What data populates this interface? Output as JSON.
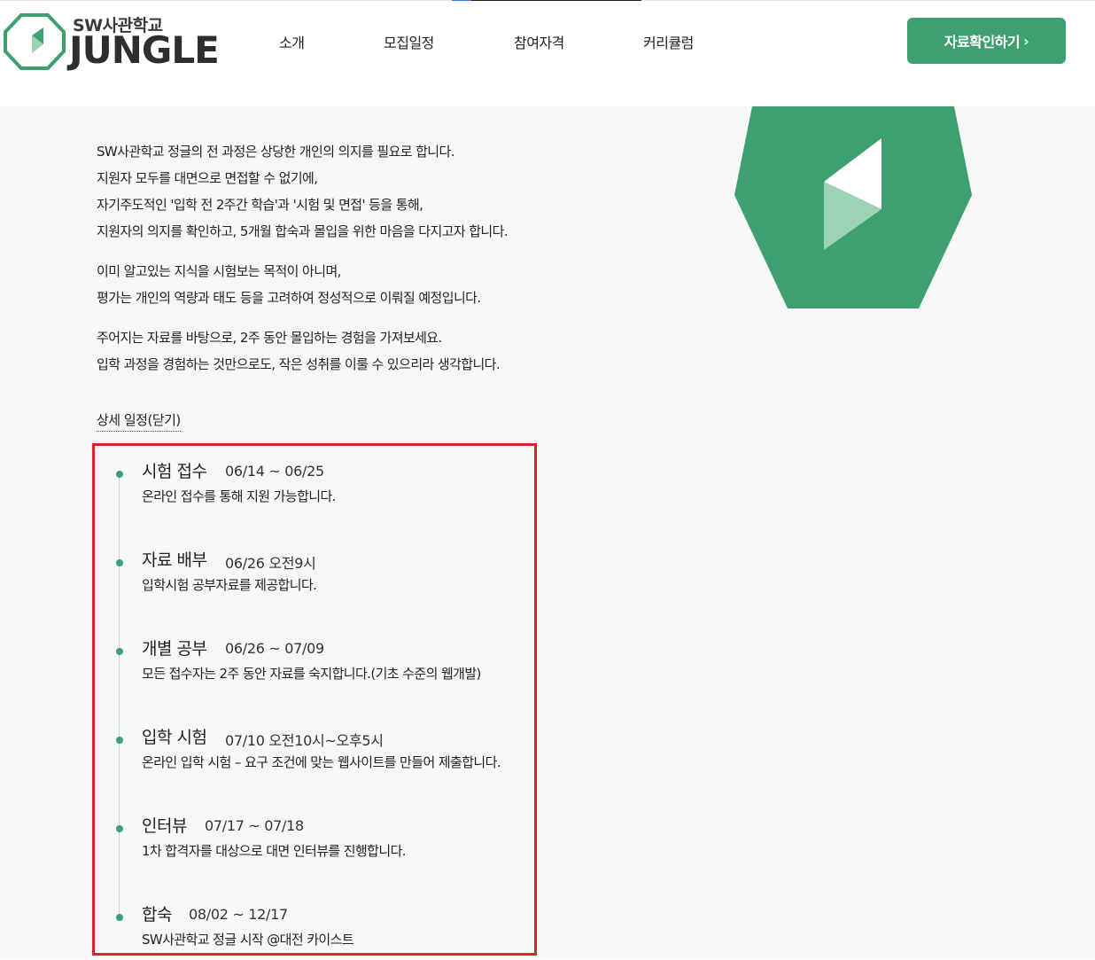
{
  "header": {
    "logo_sub": "SW사관학교",
    "logo_main": "JUNGLE",
    "nav": [
      "소개",
      "모집일정",
      "참여자격",
      "커리큘럼"
    ],
    "cta_label": "자료확인하기",
    "cta_chevron": "›"
  },
  "colors": {
    "brand_green": "#3fa06f",
    "highlight_border": "#e0202a",
    "background": "#f6f7f9"
  },
  "intro": {
    "p1": [
      "SW사관학교 정글의 전 과정은 상당한 개인의 의지를 필요로 합니다.",
      "지원자 모두를 대면으로 면접할 수 없기에,",
      "자기주도적인 '입학 전 2주간 학습'과 '시험 및 면접' 등을 통해,",
      "지원자의 의지를 확인하고, 5개월 합숙과 몰입을 위한 마음을 다지고자 합니다."
    ],
    "p2": [
      "이미 알고있는 지식을 시험보는 목적이 아니며,",
      "평가는 개인의 역량과 태도 등을 고려하여 정성적으로 이뤄질 예정입니다."
    ],
    "p3": [
      "주어지는 자료를 바탕으로, 2주 동안 몰입하는 경험을 가져보세요.",
      "입학 과정을 경험하는 것만으로도, 작은 성취를 이룰 수 있으리라 생각합니다."
    ]
  },
  "schedule_toggle": "상세 일정(닫기)",
  "schedule": [
    {
      "title": "시험 접수",
      "date": "06/14 ~ 06/25",
      "desc": "온라인 접수를 통해 지원 가능합니다."
    },
    {
      "title": "자료 배부",
      "date": "06/26 오전9시",
      "desc": "입학시험 공부자료를 제공합니다."
    },
    {
      "title": "개별 공부",
      "date": "06/26 ~ 07/09",
      "desc": "모든 접수자는 2주 동안 자료를 숙지합니다.(기초 수준의 웹개발)"
    },
    {
      "title": "입학 시험",
      "date": "07/10 오전10시~오후5시",
      "desc": "온라인 입학 시험 – 요구 조건에 맞는 웹사이트를 만들어 제출합니다."
    },
    {
      "title": "인터뷰",
      "date": "07/17 ~ 07/18",
      "desc": "1차 합격자를 대상으로 대면 인터뷰를 진행합니다."
    },
    {
      "title": "합숙",
      "date": "08/02 ~ 12/17",
      "desc": "SW사관학교 정글 시작 @대전 카이스트"
    }
  ]
}
